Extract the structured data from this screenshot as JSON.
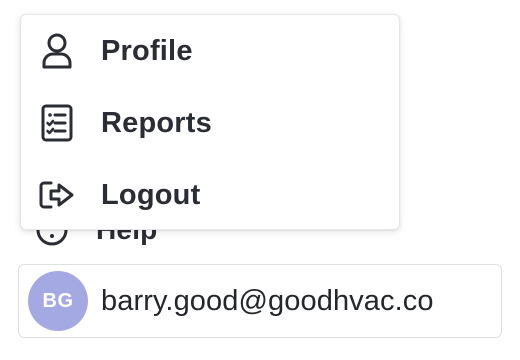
{
  "menu": {
    "items": [
      {
        "label": "Profile",
        "icon": "user-icon"
      },
      {
        "label": "Reports",
        "icon": "checklist-icon"
      },
      {
        "label": "Logout",
        "icon": "logout-icon"
      }
    ]
  },
  "sidebar": {
    "help_label": "Help",
    "help_icon": "help-icon"
  },
  "account": {
    "initials": "BG",
    "email": "barry.good@goodhvac.co",
    "avatar_color": "#a5a9e3"
  }
}
